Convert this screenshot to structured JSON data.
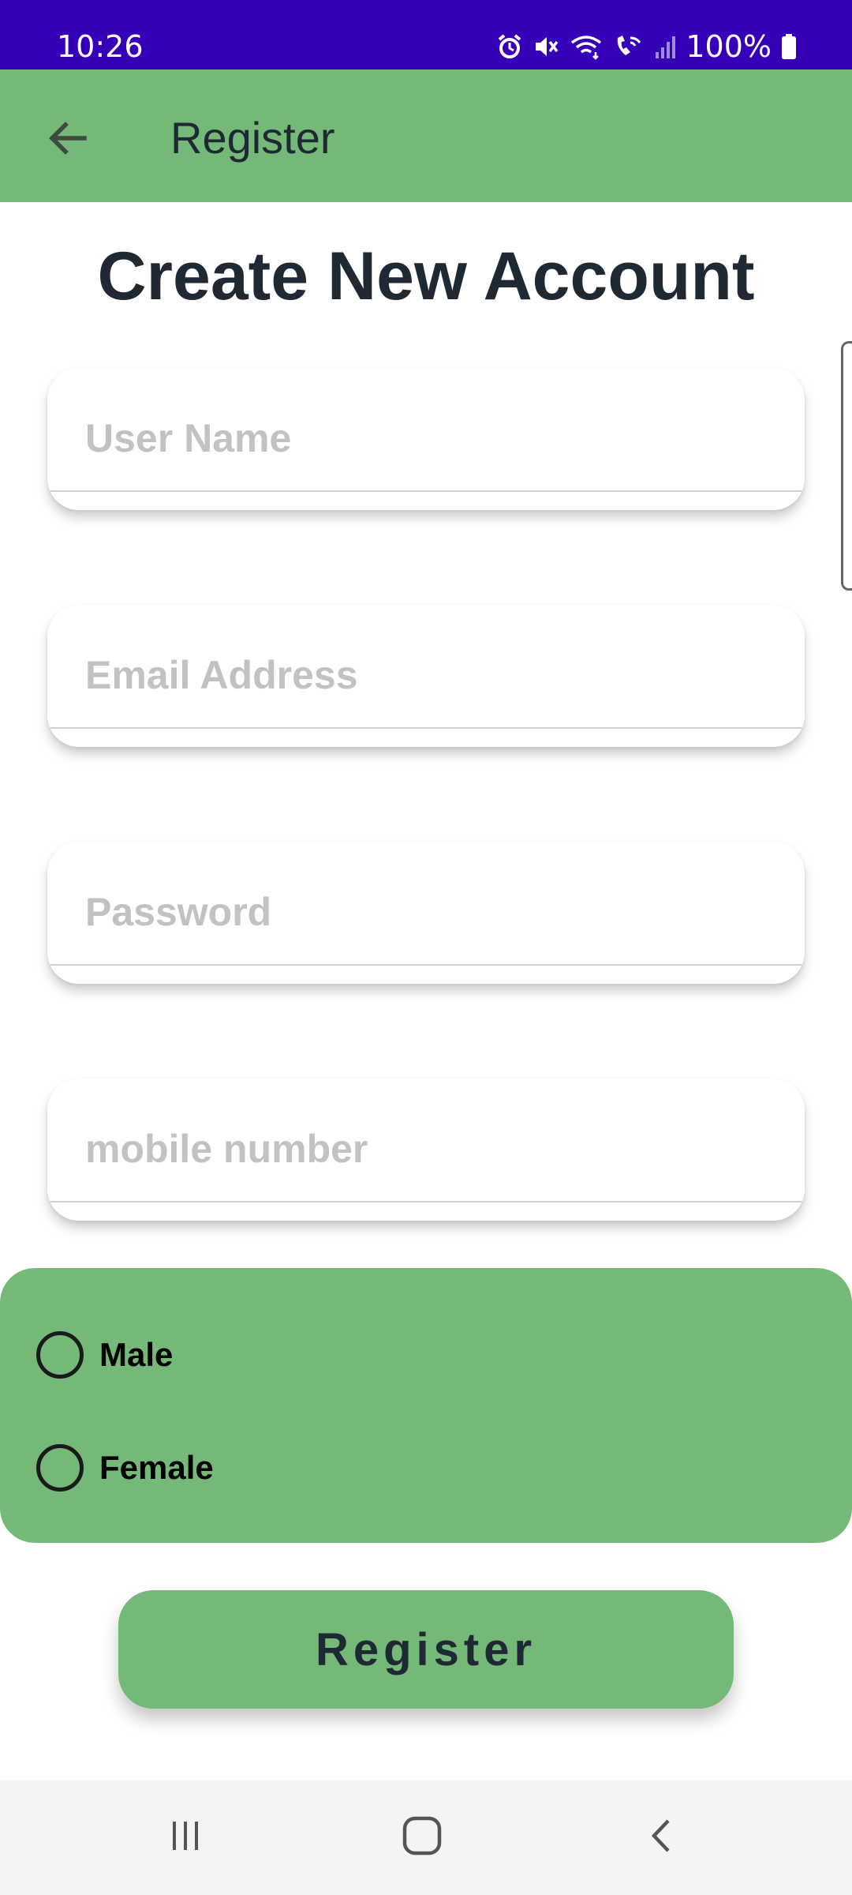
{
  "status_bar": {
    "time": "10:26",
    "battery": "100%",
    "icons": [
      "alarm-icon",
      "mute-icon",
      "wifi-icon",
      "wifi-call-icon",
      "signal-icon",
      "battery-icon"
    ]
  },
  "app_bar": {
    "title": "Register",
    "back_icon": "arrow-left-icon"
  },
  "page": {
    "title": "Create New Account"
  },
  "form": {
    "username": {
      "placeholder": "User Name",
      "value": ""
    },
    "email": {
      "placeholder": "Email Address",
      "value": ""
    },
    "password": {
      "placeholder": "Password",
      "value": ""
    },
    "mobile": {
      "placeholder": "mobile number",
      "value": ""
    }
  },
  "gender": {
    "options": [
      {
        "label": "Male",
        "selected": false
      },
      {
        "label": "Female",
        "selected": false
      }
    ]
  },
  "register_button": {
    "label": "Register"
  },
  "nav_bar": {
    "icons": [
      "recent-apps-icon",
      "home-icon",
      "back-icon"
    ]
  },
  "colors": {
    "status_bar": "#3500b8",
    "accent_green": "#74b977",
    "text_dark": "#1f2933",
    "placeholder": "#c2c2c2"
  }
}
